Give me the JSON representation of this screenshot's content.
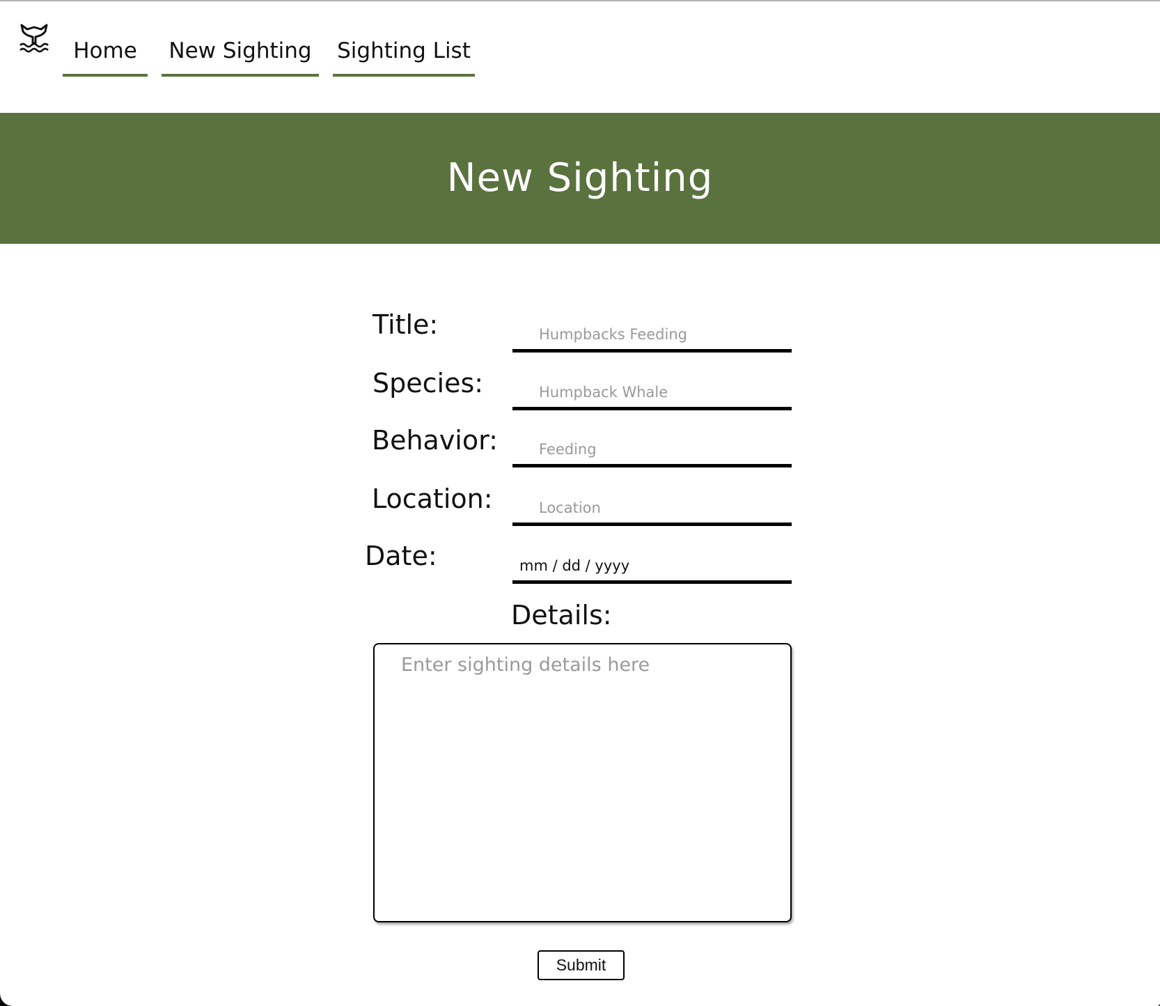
{
  "nav": {
    "logo_icon": "whale-tail-waves-icon",
    "items": [
      {
        "label": "Home"
      },
      {
        "label": "New Sighting"
      },
      {
        "label": "Sighting List"
      }
    ],
    "accent_color": "#5b733e"
  },
  "hero": {
    "title": "New Sighting",
    "background_color": "#5a723e"
  },
  "form": {
    "title": {
      "label": "Title:",
      "placeholder": "Humpbacks Feeding"
    },
    "species": {
      "label": "Species:",
      "placeholder": "Humpback Whale"
    },
    "behavior": {
      "label": "Behavior:",
      "placeholder": "Feeding"
    },
    "location": {
      "label": "Location:",
      "placeholder": "Location"
    },
    "date": {
      "label": "Date:",
      "placeholder": "mm / dd / yyyy"
    },
    "details": {
      "label": "Details:",
      "placeholder": "Enter sighting details here"
    },
    "submit_label": "Submit"
  }
}
